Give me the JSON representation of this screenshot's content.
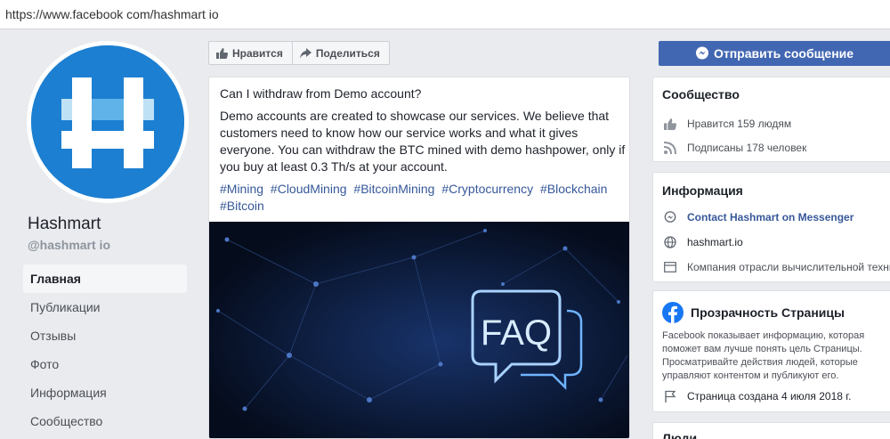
{
  "browser": {
    "url": "https://www.facebook com/hashmart io"
  },
  "page": {
    "name": "Hashmart",
    "handle": "@hashmart io"
  },
  "nav": {
    "items": [
      {
        "label": "Главная"
      },
      {
        "label": "Публикации"
      },
      {
        "label": "Отзывы"
      },
      {
        "label": "Фото"
      },
      {
        "label": "Информация"
      },
      {
        "label": "Сообщество"
      }
    ]
  },
  "actions": {
    "like_label": "Нравится",
    "share_label": "Поделиться",
    "send_message_label": "Отправить сообщение"
  },
  "post": {
    "question": "Can I withdraw from Demo account?",
    "body": "Demo accounts are created to showcase our services. We believe that customers need to know how our service works and what it gives everyone. You can withdraw the BTC mined with demo hashpower, only if you buy at least 0.3 Th/s at your account.",
    "hashtags": [
      "#Mining",
      "#CloudMining",
      "#BitcoinMining",
      "#Cryptocurrency",
      "#Blockchain",
      "#Bitcoin"
    ],
    "image_text": "FAQ"
  },
  "community": {
    "title": "Сообщество",
    "likes": "Нравится 159 людям",
    "followers": "Подписаны 178 человек"
  },
  "info": {
    "title": "Информация",
    "messenger": "Contact Hashmart on Messenger",
    "website": "hashmart.io",
    "category": "Компания отрасли вычислительной техники"
  },
  "transparency": {
    "title": "Прозрачность Страницы",
    "text": "Facebook показывает информацию, которая поможет вам лучше понять цель Страницы. Просматривайте действия людей, которые управляют контентом и публикуют его.",
    "created": "Страница создана 4 июля 2018 г."
  },
  "people": {
    "title": "Люди"
  },
  "colors": {
    "brand": "#4267b2",
    "link": "#365899",
    "avatar_bg": "#1c7fd1"
  }
}
